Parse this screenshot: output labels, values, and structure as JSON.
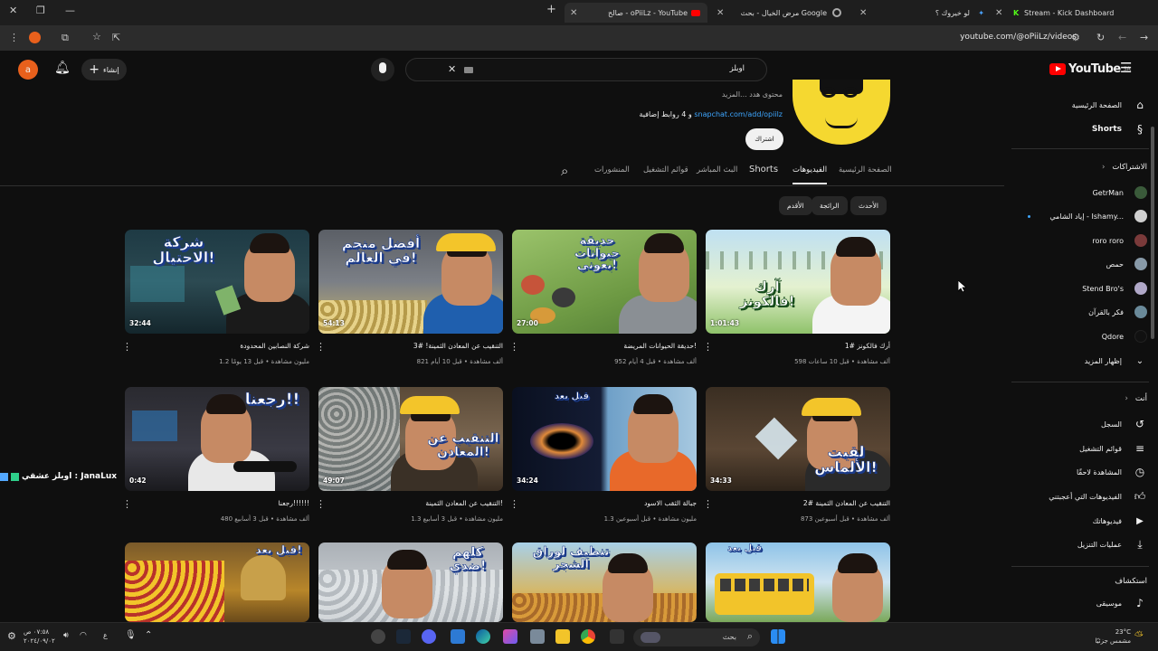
{
  "browser": {
    "tabs": [
      {
        "label": "Stream - Kick Dashboard"
      },
      {
        "label": "لو خيروك ؟"
      },
      {
        "label": "مرض الخيال - بحث Google"
      },
      {
        "label": "صالح - oPiiLz - YouTube"
      }
    ],
    "url": "youtube.com/@oPiiLz/videos"
  },
  "topbar": {
    "logo_text": "YouTube",
    "logo_region": "SA",
    "search_value": "اوبلز",
    "create_label": "إنشاء",
    "avatar_letter": "a"
  },
  "channel": {
    "desc": "محتوى هدد ...المزيد",
    "links_prefix": "و 4 روابط إضافية",
    "link": "snapchat.com/add/opiilz",
    "subscribe_label": "اشتراك",
    "tabs": [
      {
        "label": "الصفحة الرئيسية"
      },
      {
        "label": "الفيديوهات"
      },
      {
        "label": "Shorts"
      },
      {
        "label": "البث المباشر"
      },
      {
        "label": "قوائم التشغيل"
      },
      {
        "label": "المنشورات"
      }
    ]
  },
  "filters": [
    "الأحدث",
    "الرائجة",
    "الأقدم"
  ],
  "videos": [
    {
      "title": "أرك فالكونز #1",
      "meta": "598 ألف مشاهدة • قبل 10 ساعات",
      "duration": "1:01:43",
      "thumb_text": "آرك فالكونز!"
    },
    {
      "title": "حديقة الحيوانات المريضة!",
      "meta": "952 ألف مشاهدة • قبل 4 أيام",
      "duration": "27:00",
      "thumb_text": "حديقة حيوانات بعوني!"
    },
    {
      "title": "التنقيب عن المعادن الثمينة! #3",
      "meta": "821 ألف مشاهدة • قبل 10 أيام",
      "duration": "54:13",
      "thumb_text": "أفضل منجم في العالم!"
    },
    {
      "title": "شركة النصابين المحدودة",
      "meta": "1.2 مليون مشاهدة • قبل 13 يومًا",
      "duration": "32:44",
      "thumb_text": "شركة الاحتيال!"
    },
    {
      "title": "التنقيب عن المعادن الثمينة #2",
      "meta": "873 ألف مشاهدة • قبل أسبوعين",
      "duration": "34:33",
      "thumb_text": "لقيت الألماس!"
    },
    {
      "title": "جبالة الثقب الاسود",
      "meta": "1.3 مليون مشاهدة • قبل أسبوعين",
      "duration": "34:24",
      "thumb_text": "قبل بعد"
    },
    {
      "title": "التنقيب عن المعادن الثمينة!",
      "meta": "1.3 مليون مشاهدة • قبل 3 أسابيع",
      "duration": "49:07",
      "thumb_text": "التنقيب عن المعادن!"
    },
    {
      "title": "رجعنا!!!!!!",
      "meta": "480 ألف مشاهدة • قبل 3 أسابيع",
      "duration": "0:42",
      "thumb_text": "رجعنا!!"
    },
    {
      "title": "",
      "meta": "",
      "duration": "",
      "thumb_text": "قبل بعد"
    },
    {
      "title": "",
      "meta": "",
      "duration": "",
      "thumb_text": "تنظيف لوراق الشجر"
    },
    {
      "title": "",
      "meta": "",
      "duration": "",
      "thumb_text": "كلهم ضدي!"
    },
    {
      "title": "",
      "meta": "",
      "duration": "",
      "thumb_text": "قبل بعد!"
    }
  ],
  "sidebar": {
    "home": "الصفحة الرئيسية",
    "shorts": "Shorts",
    "subs_header": "الاشتراكات",
    "subs": [
      {
        "name": "GetrMan",
        "color": "#3a5a3a"
      },
      {
        "name": "إياد الشامي - Ishamy...",
        "color": "#cfcfcf"
      },
      {
        "name": "roro roro",
        "color": "#7a3a3a"
      },
      {
        "name": "حمص",
        "color": "#889aa8"
      },
      {
        "name": "Stend Bro's",
        "color": "#b0a8c8"
      },
      {
        "name": "فكر بالقرآن",
        "color": "#6a8a9a"
      },
      {
        "name": "Qdore",
        "color": "#111111"
      }
    ],
    "show_more": "إظهار المزيد",
    "you_header": "أنت",
    "you_items": [
      {
        "label": "السجل",
        "icon": "history-icon"
      },
      {
        "label": "قوائم التشغيل",
        "icon": "playlist-icon"
      },
      {
        "label": "المشاهدة لاحقًا",
        "icon": "clock-icon"
      },
      {
        "label": "الفيديوهات التي أعجبتني",
        "icon": "like-icon"
      },
      {
        "label": "فيديوهاتك",
        "icon": "your-videos-icon"
      },
      {
        "label": "عمليات التنزيل",
        "icon": "download-icon"
      }
    ],
    "explore_header": "استكشاف",
    "music": "موسيقى"
  },
  "overlay": {
    "text": "اوبلز عشقي : JanaLux"
  },
  "taskbar": {
    "search_label": "بحث",
    "time": "٠٧:٥٨ ص",
    "date": "٢٠٢٤/٠٩/٠٢",
    "lang": "ع",
    "weather_temp": "23°C",
    "weather_desc": "مشمس جزئيًا"
  }
}
